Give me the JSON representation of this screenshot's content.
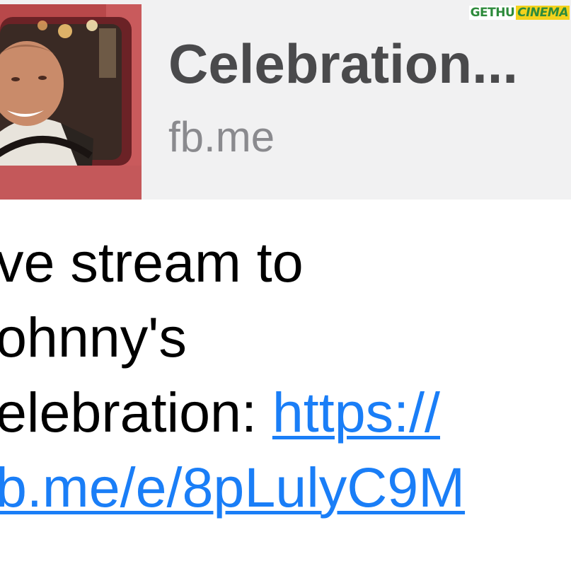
{
  "preview": {
    "title": "Celebration...",
    "domain": "fb.me",
    "thumbnail_icon": "person-in-red-truck-photo"
  },
  "watermark": {
    "part1": "GETHU",
    "part2": "CINEMA"
  },
  "message": {
    "line1": "ve stream to",
    "line2": "ohnny's",
    "line3_text": "elebration: ",
    "line3_link": "https://",
    "line4_link": "b.me/e/8pLulyC9M"
  },
  "colors": {
    "link": "#1a7ef7",
    "card_bg": "#f1f1f2",
    "title": "#4a4a4c",
    "domain": "#8a8a8e"
  }
}
